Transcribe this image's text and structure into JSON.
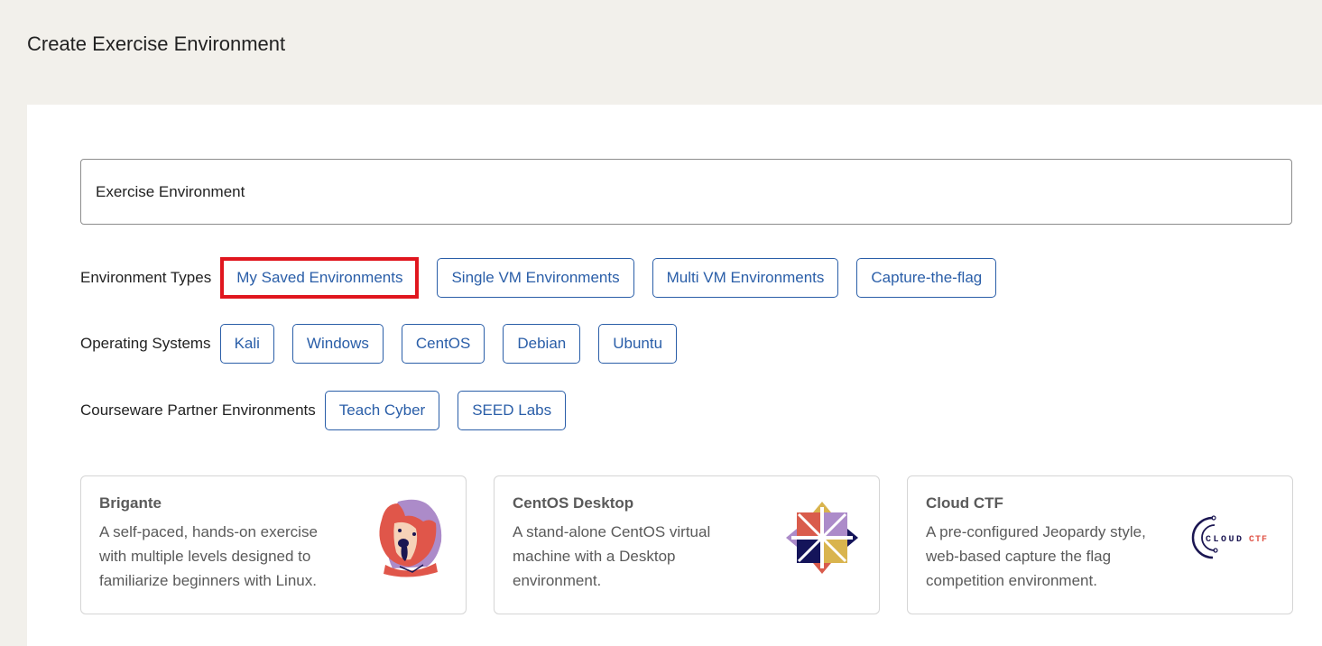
{
  "page": {
    "title": "Create Exercise Environment"
  },
  "search": {
    "value": "Exercise Environment"
  },
  "filters": {
    "environment_types": {
      "label": "Environment Types",
      "options": [
        "My Saved Environments",
        "Single VM Environments",
        "Multi VM Environments",
        "Capture-the-flag"
      ],
      "highlighted": "My Saved Environments"
    },
    "operating_systems": {
      "label": "Operating Systems",
      "options": [
        "Kali",
        "Windows",
        "CentOS",
        "Debian",
        "Ubuntu"
      ]
    },
    "courseware_partners": {
      "label": "Courseware Partner Environments",
      "options": [
        "Teach Cyber",
        "SEED Labs"
      ]
    }
  },
  "cards": [
    {
      "title": "Brigante",
      "description": "A self-paced, hands-on exercise with multiple levels designed to familiarize beginners with Linux.",
      "logo": "brigante-dog-logo"
    },
    {
      "title": "CentOS Desktop",
      "description": "A stand-alone CentOS virtual machine with a Desktop environment.",
      "logo": "centos-logo"
    },
    {
      "title": "Cloud CTF",
      "description": "A pre-configured Jeopardy style, web-based capture the flag competition environment.",
      "logo": "cloud-ctf-logo",
      "logo_text": "CLOUD CTF"
    }
  ],
  "colors": {
    "accent": "#2a5ea8",
    "highlight": "#e0161e",
    "background": "#f2f0eb"
  }
}
